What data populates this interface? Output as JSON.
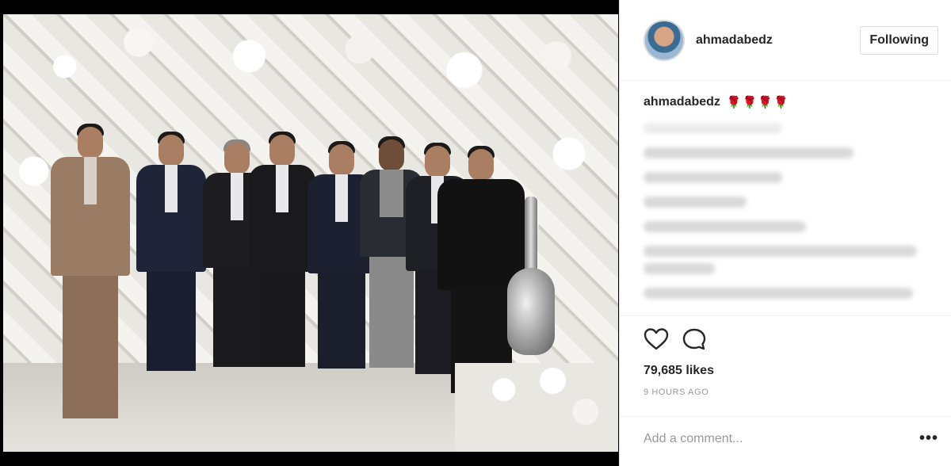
{
  "post": {
    "username": "ahmadabedz",
    "follow_label": "Following",
    "caption_user": "ahmadabedz",
    "caption_emoji": [
      "🌹",
      "🌹",
      "🌹",
      "🌹"
    ],
    "likes": "79,685 likes",
    "time": "9 HOURS AGO",
    "comment_placeholder": "Add a comment...",
    "more_label": "•••"
  },
  "icons": {
    "like": "heart-icon",
    "comment": "comment-bubble-icon",
    "more": "more-options-icon"
  },
  "colors": {
    "text": "#262626",
    "muted": "#999999",
    "rose": "#c9302c"
  }
}
